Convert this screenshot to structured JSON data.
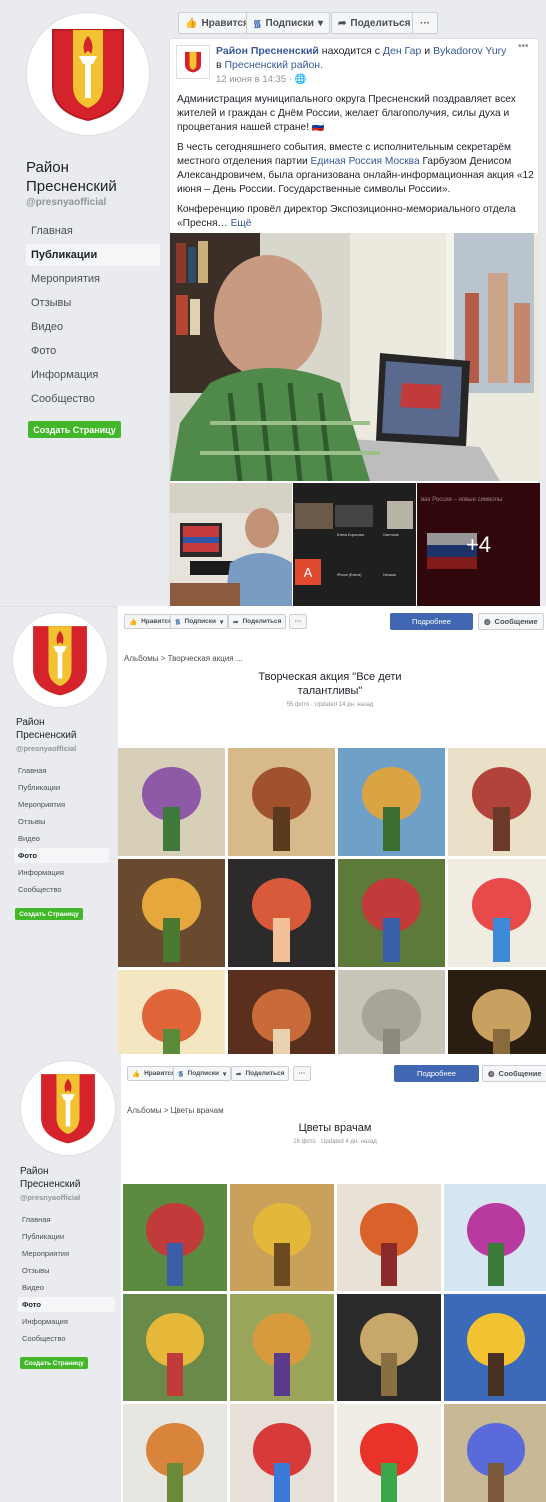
{
  "page": {
    "name": "Район Пресненский",
    "handle": "@presnyaofficial",
    "create_page": "Создать Страницу",
    "nav": [
      "Главная",
      "Публикации",
      "Мероприятия",
      "Отзывы",
      "Видео",
      "Фото",
      "Информация",
      "Сообщество"
    ]
  },
  "actions": {
    "like": "Нравится",
    "follow": "Подписки",
    "share": "Поделиться",
    "more": "···",
    "details": "Подробнее",
    "message": "Сообщение"
  },
  "post": {
    "author": "Район Пресненский",
    "with_text": "находится с",
    "friend1": "Ден Гар",
    "and": "и",
    "friend2": "Bykadorov Yury",
    "in_text": "в",
    "place": "Пресненский район.",
    "time": "12 июня в 14:35 ·",
    "options": "•••",
    "p1": "Администрация муниципального округа Пресненский поздравляет всех жителей и граждан с Днём России, желает благополучия, силы духа и процветания нашей стране! 🇷🇺",
    "p2a": "В честь сегодняшнего события, вместе с исполнительным секретарём местного отделения партии",
    "p2link": "Единая Россия Москва",
    "p2b": "Гарбузом Денисом Александровичем, была организована онлайн-информационная акция «12 июня – День России. Государственные символы России».",
    "p3": "Конференцию провёл директор Экспозиционно-мемориального отдела «Пресня…",
    "more": "Ещё",
    "plus_count": "+4",
    "thumb3_caption": "вах Россия – новые символы",
    "zoom_letter": "A",
    "zoom_labels": [
      "Елена Борисова",
      "Светлана",
      "iPhone (Елена)",
      "Наташа"
    ]
  },
  "album1": {
    "breadcrumb_root": "Альбомы",
    "sep": ">",
    "breadcrumb_current": "Творческая акция ...",
    "title": "Творческая акция \"Все дети талантливы\"",
    "meta": "55 фото · Updated 14 дн. назад"
  },
  "album2": {
    "breadcrumb_root": "Альбомы",
    "sep": ">",
    "breadcrumb_current": "Цветы врачам",
    "title": "Цветы врачам",
    "meta": "16 фото · Updated 4 дн. назад"
  },
  "colors": {
    "accent": "#4267b2",
    "link": "#385898",
    "green": "#42b72a",
    "logo_red": "#d4232b",
    "logo_gold": "#f2c231"
  }
}
